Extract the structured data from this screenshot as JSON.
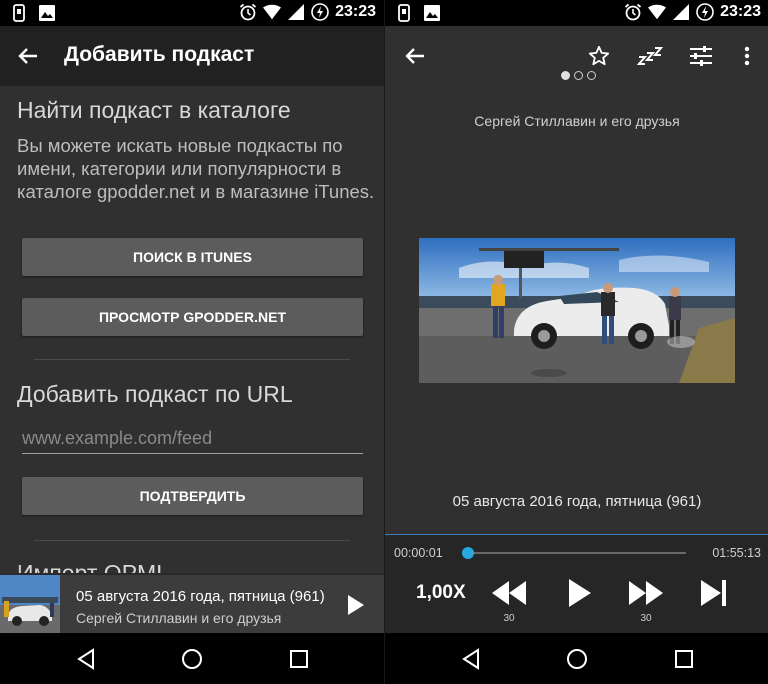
{
  "left_screen": {
    "status_bar": {
      "time": "23:23"
    },
    "app_bar": {
      "title": "Добавить подкаст"
    },
    "catalog_section": {
      "heading": "Найти подкаст в каталоге",
      "description": "Вы можете искать новые подкасты по имени, категории или популярности в каталоге gpodder.net и в магазине iTunes.",
      "itunes_button": "ПОИСК В ITUNES",
      "gpodder_button": "ПРОСМОТР GPODDER.NET"
    },
    "url_section": {
      "heading": "Добавить подкаст по URL",
      "url_placeholder": "www.example.com/feed",
      "confirm_button": "ПОДТВЕРДИТЬ"
    },
    "opml_section": {
      "heading": "Импорт OPML"
    },
    "mini_player": {
      "episode_title": "05 августа 2016 года, пятница (961)",
      "podcast_author": "Сергей Стиллавин и его друзья"
    }
  },
  "right_screen": {
    "status_bar": {
      "time": "23:23"
    },
    "podcast_author": "Сергей Стиллавин и его друзья",
    "episode_title": "05 августа 2016 года, пятница (961)",
    "position": "00:00:01",
    "duration": "01:55:13",
    "progress_fraction": 0.0,
    "playback_speed": "1,00X",
    "rewind_seconds": "30",
    "forward_seconds": "30",
    "page_dots": {
      "count": 3,
      "active_index": 0
    }
  },
  "colors": {
    "accent": "#29a8e0",
    "app_bar": "#212121",
    "background": "#303030",
    "button": "#5c5c5c"
  },
  "icons": [
    "back-arrow-icon",
    "star-icon",
    "sleep-timer-icon",
    "equalizer-icon",
    "overflow-menu-icon",
    "play-icon",
    "rewind-icon",
    "fast-forward-icon",
    "skip-next-icon",
    "nav-back-icon",
    "nav-home-icon",
    "nav-recents-icon",
    "alarm-icon",
    "wifi-icon",
    "signal-icon",
    "battery-charging-icon",
    "image-notification-icon",
    "sim-notification-icon"
  ]
}
